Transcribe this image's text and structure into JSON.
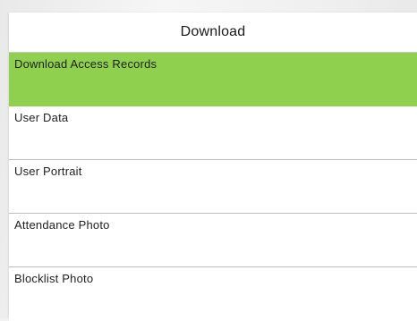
{
  "header": {
    "title": "Download"
  },
  "menu": {
    "selected_index": 0,
    "accent_color": "#8fd14f",
    "items": [
      {
        "label": "Download Access Records"
      },
      {
        "label": "User Data"
      },
      {
        "label": "User Portrait"
      },
      {
        "label": "Attendance Photo"
      },
      {
        "label": "Blocklist Photo"
      }
    ]
  }
}
